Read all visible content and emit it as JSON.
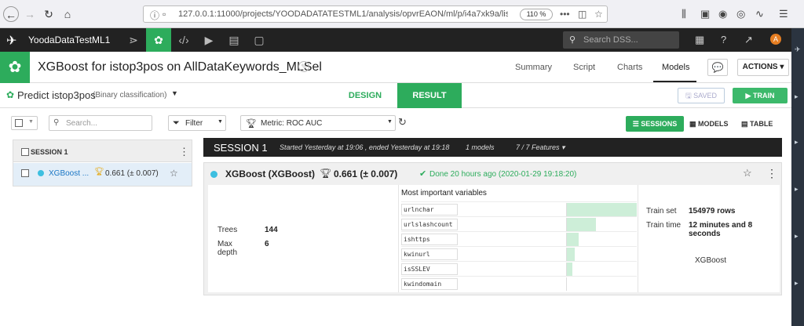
{
  "browser": {
    "url": "127.0.0.1:11000/projects/YOODADATATESTML1/analysis/opvrEAON/ml/p/i4a7xk9a/list/re",
    "zoom": "110 %"
  },
  "app": {
    "project_name": "YoodaDataTestML1",
    "search_placeholder": "Search DSS...",
    "avatar_letter": "A"
  },
  "model_header": {
    "title": "XGBoost for istop3pos on AllDataKeywords_MLSel",
    "tabs": [
      "Summary",
      "Script",
      "Charts",
      "Models"
    ],
    "active_tab": "Models",
    "actions_label": "ACTIONS"
  },
  "sub_header": {
    "predict_label": "Predict istop3pos",
    "predict_type": "(Binary classification)",
    "design_tab": "DESIGN",
    "result_tab": "RESULT",
    "saved_label": "SAVED",
    "train_label": "TRAIN"
  },
  "filter_bar": {
    "search_placeholder": "Search...",
    "filter_label": "Filter",
    "metric_label": "Metric: ROC AUC",
    "view_sessions": "SESSIONS",
    "view_models": "MODELS",
    "view_table": "TABLE"
  },
  "left_panel": {
    "session_label": "SESSION 1",
    "model_name": "XGBoost ...",
    "model_score": "0.661 (± 0.007)"
  },
  "session": {
    "title": "SESSION 1",
    "time": "Started Yesterday at 19:06 , ended Yesterday at 19:18",
    "models_count": "1 models",
    "features": "7 / 7 Features"
  },
  "model_card": {
    "name": "XGBoost (XGBoost)",
    "score": "0.661 (± 0.007)",
    "done": "Done 20 hours ago (2020-01-29 19:18:20)",
    "params": [
      {
        "label": "Trees",
        "value": "144"
      },
      {
        "label": "Max depth",
        "value": "6"
      }
    ],
    "vars_title": "Most important variables",
    "variables": [
      {
        "name": "urlnchar",
        "importance": 1.0
      },
      {
        "name": "urlslashcount",
        "importance": 0.42
      },
      {
        "name": "ishttps",
        "importance": 0.18
      },
      {
        "name": "kwinurl",
        "importance": 0.12
      },
      {
        "name": "isSSLEV",
        "importance": 0.09
      },
      {
        "name": "kwindomain",
        "importance": 0.0
      }
    ],
    "train": [
      {
        "label": "Train set",
        "value": "154979 rows"
      },
      {
        "label": "Train time",
        "value": "12 minutes and 8 seconds"
      }
    ],
    "algorithm": "XGBoost"
  },
  "colors": {
    "accent": "#2dac5c",
    "bar": "#cdeed8",
    "model_dot": "#3dbfe0"
  }
}
